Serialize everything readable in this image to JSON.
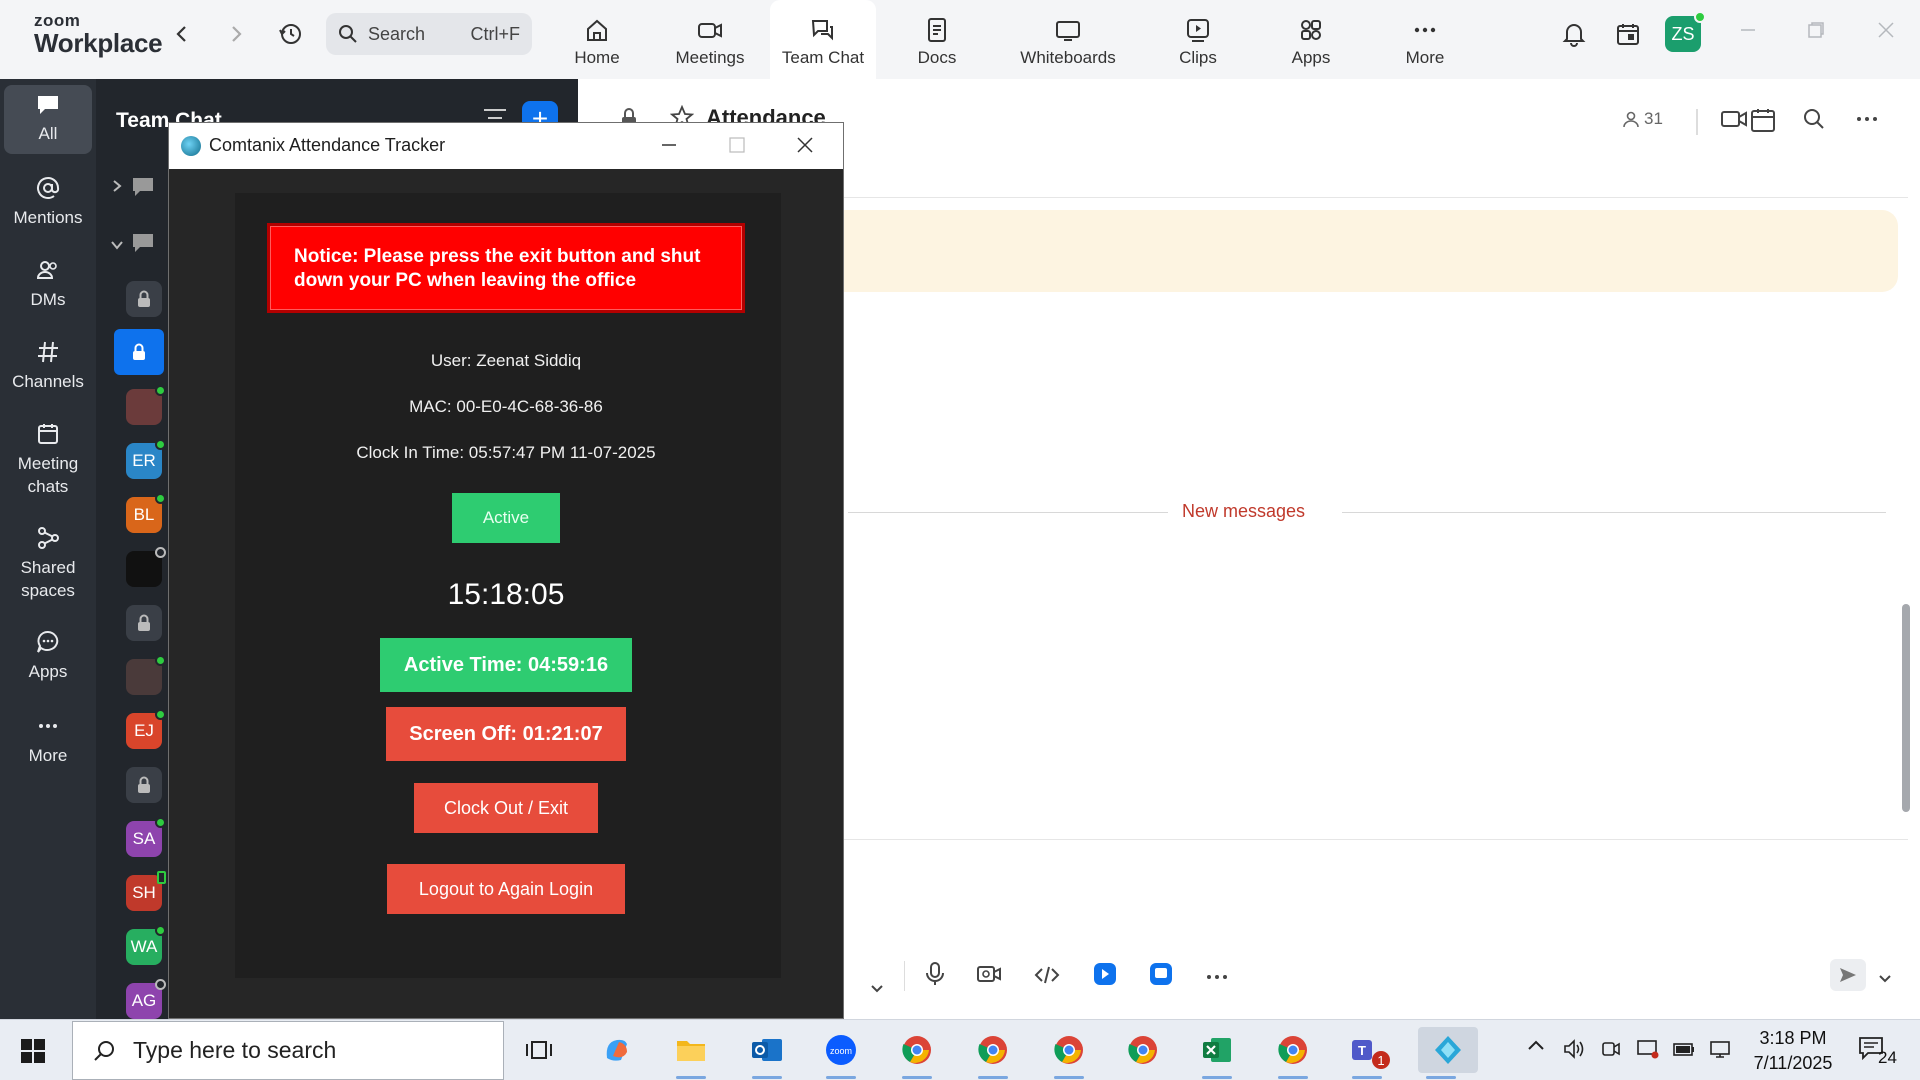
{
  "zoom": {
    "logo_line1": "zoom",
    "logo_line2": "Workplace",
    "search_placeholder": "Search",
    "search_shortcut": "Ctrl+F",
    "nav": [
      {
        "label": "Home",
        "icon": "home-icon"
      },
      {
        "label": "Meetings",
        "icon": "video-icon"
      },
      {
        "label": "Team Chat",
        "icon": "chat-icon",
        "active": true
      },
      {
        "label": "Docs",
        "icon": "docs-icon"
      },
      {
        "label": "Whiteboards",
        "icon": "whiteboard-icon"
      },
      {
        "label": "Clips",
        "icon": "clips-icon"
      },
      {
        "label": "Apps",
        "icon": "apps-icon"
      },
      {
        "label": "More",
        "icon": "more-icon"
      }
    ],
    "user_initials": "ZS",
    "accent": "#0e72ed"
  },
  "rail": [
    {
      "label": "All",
      "icon": "chat-bubble-icon",
      "active": true
    },
    {
      "label": "Mentions",
      "icon": "at-icon"
    },
    {
      "label": "DMs",
      "icon": "people-icon"
    },
    {
      "label": "Channels",
      "icon": "hash-icon"
    },
    {
      "label": "Meeting chats",
      "icon": "calendar-icon"
    },
    {
      "label": "Shared spaces",
      "icon": "share-icon"
    },
    {
      "label": "Apps",
      "icon": "apps-chat-icon"
    },
    {
      "label": "More",
      "icon": "more-icon"
    }
  ],
  "chatlist": {
    "title": "Team Chat",
    "avatars": [
      {
        "initials": "ER",
        "color": "#2a86c7"
      },
      {
        "initials": "BL",
        "color": "#d9661a"
      },
      {
        "initials": "EJ",
        "color": "#d9452b"
      },
      {
        "initials": "SA",
        "color": "#8e44ad"
      },
      {
        "initials": "SH",
        "color": "#c0392b"
      },
      {
        "initials": "WA",
        "color": "#27ae60"
      },
      {
        "initials": "AG",
        "color": "#8e44ad"
      }
    ]
  },
  "channel": {
    "title": "Attendance",
    "members": "31",
    "new_messages": "New messages"
  },
  "tracker": {
    "title": "Comtanix Attendance Tracker",
    "notice": "Notice: Please press the exit button and shut down your PC when leaving the office",
    "user": "User: Zeenat Siddiq",
    "mac": "MAC: 00-E0-4C-68-36-86",
    "clock_in": "Clock In Time: 05:57:47 PM 11-07-2025",
    "status": "Active",
    "clock": "15:18:05",
    "active_time": "Active Time: 04:59:16",
    "screen_off": "Screen Off: 01:21:07",
    "clock_out": "Clock Out / Exit",
    "logout": "Logout to Again Login",
    "colors": {
      "notice": "#ff0000",
      "green": "#2ecc71",
      "red": "#e74c3c"
    }
  },
  "taskbar": {
    "search_placeholder": "Type here to search",
    "time": "3:18 PM",
    "date": "7/11/2025",
    "notifications": "24",
    "teams_badge": "1"
  }
}
